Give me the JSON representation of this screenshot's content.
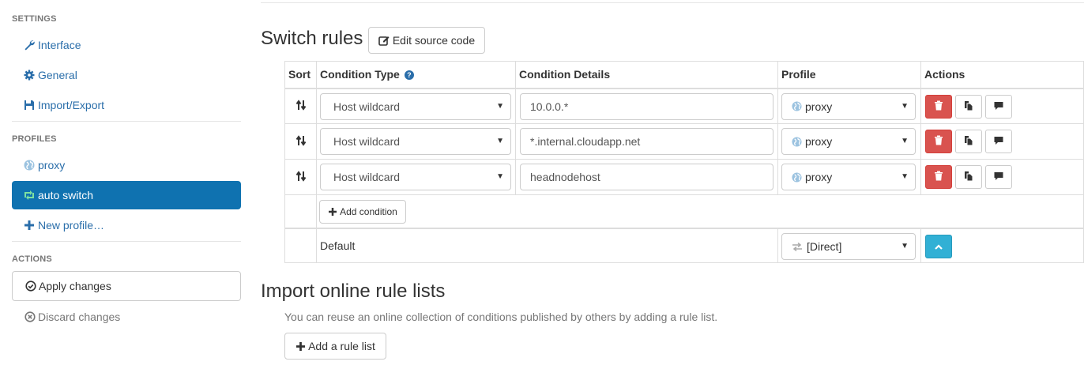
{
  "sidebar": {
    "settings_title": "SETTINGS",
    "settings_items": [
      {
        "label": "Interface",
        "icon": "wrench-icon"
      },
      {
        "label": "General",
        "icon": "gear-icon"
      },
      {
        "label": "Import/Export",
        "icon": "floppy-icon"
      }
    ],
    "profiles_title": "PROFILES",
    "profiles": [
      {
        "label": "proxy",
        "icon": "globe-icon"
      },
      {
        "label": "auto switch",
        "icon": "retweet-icon",
        "active": true
      },
      {
        "label": "New profile…",
        "icon": "plus-icon"
      }
    ],
    "actions_title": "ACTIONS",
    "apply_label": "Apply changes",
    "discard_label": "Discard changes"
  },
  "main": {
    "switch_rules_title": "Switch rules",
    "edit_source_label": "Edit source code",
    "table": {
      "headers": [
        "Sort",
        "Condition Type",
        "Condition Details",
        "Profile",
        "Actions"
      ],
      "rows": [
        {
          "condition_type": "Host wildcard",
          "details": "10.0.0.*",
          "profile": "proxy"
        },
        {
          "condition_type": "Host wildcard",
          "details": "*.internal.cloudapp.net",
          "profile": "proxy"
        },
        {
          "condition_type": "Host wildcard",
          "details": "headnodehost",
          "profile": "proxy"
        }
      ],
      "add_condition_label": "Add condition",
      "default_label": "Default",
      "default_profile": "[Direct]"
    },
    "import_title": "Import online rule lists",
    "import_desc": "You can reuse an online collection of conditions published by others by adding a rule list.",
    "add_rule_list_label": "Add a rule list"
  },
  "colors": {
    "accent": "#0f72b0",
    "link": "#2a6eaa",
    "danger": "#d9534f",
    "info": "#31b0d5"
  }
}
